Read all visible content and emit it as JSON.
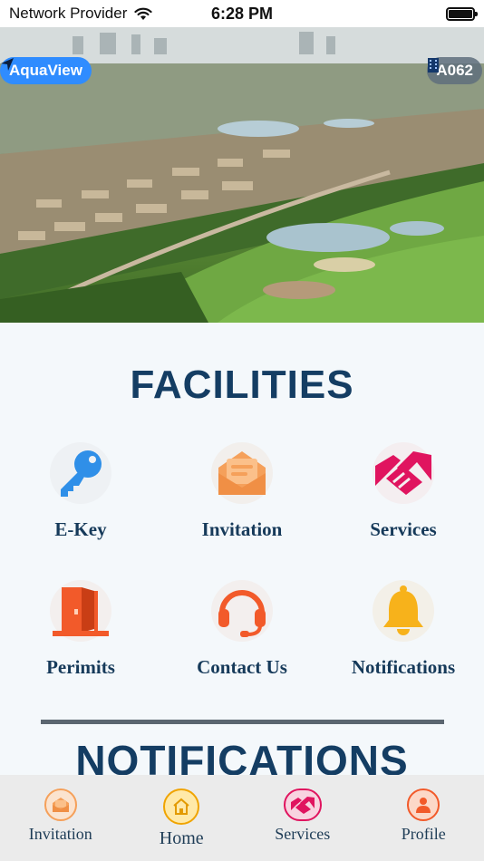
{
  "status_bar": {
    "carrier": "Network Provider",
    "time": "6:28 PM"
  },
  "hero": {
    "location_label": "AquaView",
    "unit_label": "A062"
  },
  "facilities": {
    "title": "FACILITIES",
    "items": [
      {
        "label": "E-Key",
        "icon": "key-icon",
        "color": "#2f8fe8"
      },
      {
        "label": "Invitation",
        "icon": "envelope-icon",
        "color": "#f5a05a"
      },
      {
        "label": "Services",
        "icon": "handshake-icon",
        "color": "#e0145f"
      },
      {
        "label": "Perimits",
        "icon": "door-icon",
        "color": "#f25a2a"
      },
      {
        "label": "Contact Us",
        "icon": "headset-icon",
        "color": "#f25a2a"
      },
      {
        "label": "Notifications",
        "icon": "bell-icon",
        "color": "#f7b21b"
      }
    ]
  },
  "notifications": {
    "title": "NOTIFICATIONS"
  },
  "bottom_nav": {
    "items": [
      {
        "label": "Invitation",
        "icon": "envelope-icon"
      },
      {
        "label": "Home",
        "icon": "home-icon",
        "active": true
      },
      {
        "label": "Services",
        "icon": "handshake-icon"
      },
      {
        "label": "Profile",
        "icon": "user-icon"
      }
    ]
  }
}
